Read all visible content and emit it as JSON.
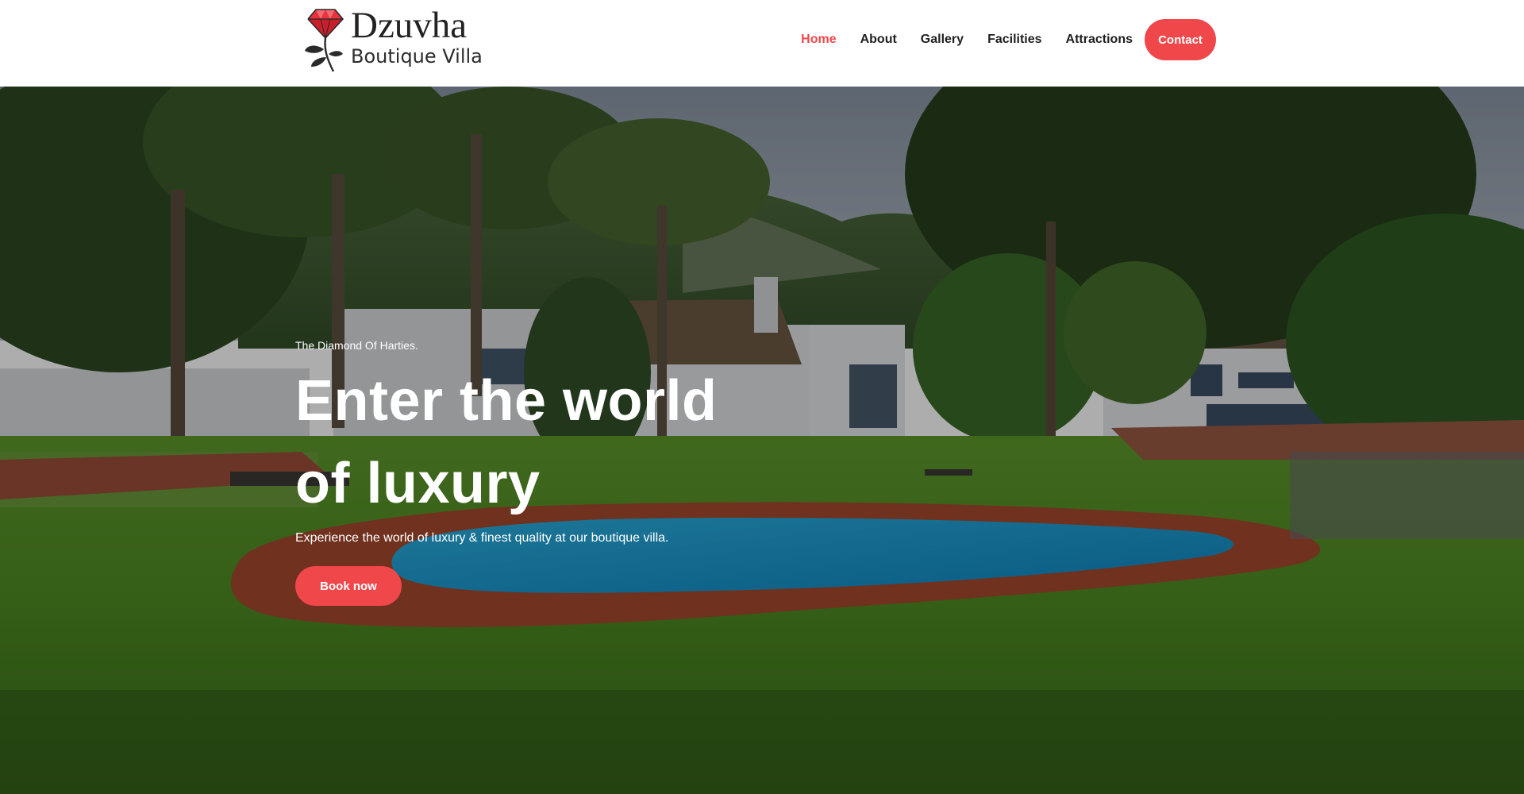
{
  "brand": {
    "name": "Dzuvha",
    "subtitle": "Boutique Villa",
    "accent_color": "#f0474b",
    "logo_icon": "diamond-rose-icon"
  },
  "nav": {
    "items": [
      {
        "label": "Home",
        "active": true
      },
      {
        "label": "About",
        "active": false
      },
      {
        "label": "Gallery",
        "active": false
      },
      {
        "label": "Facilities",
        "active": false
      },
      {
        "label": "Attractions",
        "active": false
      }
    ],
    "contact_label": "Contact"
  },
  "hero": {
    "eyebrow": "The Diamond Of Harties.",
    "title_line1": "Enter the world",
    "title_line2": "of luxury",
    "subtitle": "Experience the world of luxury & finest quality at our boutique villa.",
    "button_label": "Book now",
    "background": "villa-pool-garden-photo"
  }
}
